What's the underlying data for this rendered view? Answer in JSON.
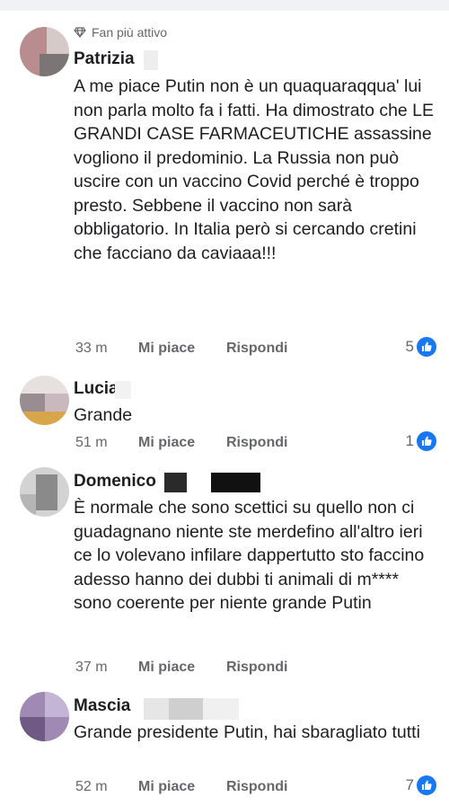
{
  "comments": [
    {
      "badge": "Fan più attivo",
      "name": "Patrizia",
      "text": "A me piace Putin non è un quaquaraqqua' lui non parla molto fa i fatti. Ha dimostrato che LE GRANDI CASE FARMACEUTICHE assassine vogliono il predominio. La Russia non può uscire con un vaccino Covid perché è troppo presto. Sebbene il vaccino non sarà obbligatorio.  In Italia però si cercando cretini che facciano da caviaaa!!!",
      "time": "33 m",
      "like": "Mi piace",
      "reply": "Rispondi",
      "reactions": "5"
    },
    {
      "name": "Lucia",
      "text": "Grande",
      "time": "51 m",
      "like": "Mi piace",
      "reply": "Rispondi",
      "reactions": "1"
    },
    {
      "name": "Domenico",
      "text": "È normale che sono scettici su quello non ci guadagnano niente ste merdefino all'altro ieri ce lo volevano infilare dappertutto sto faccino adesso hanno dei dubbi ti animali di m**** sono coerente per niente grande Putin",
      "time": "37 m",
      "like": "Mi piace",
      "reply": "Rispondi",
      "reactions": ""
    },
    {
      "name": "Mascia",
      "text": "Grande presidente Putin,  hai sbaragliato tutti",
      "time": "52 m",
      "like": "Mi piace",
      "reply": "Rispondi",
      "reactions": "7"
    }
  ],
  "colors": {
    "accent": "#1877f2",
    "meta": "#65676b",
    "text": "#1c1e21"
  },
  "icons": {
    "badge": "diamond-icon",
    "reaction": "like-thumb-icon"
  }
}
